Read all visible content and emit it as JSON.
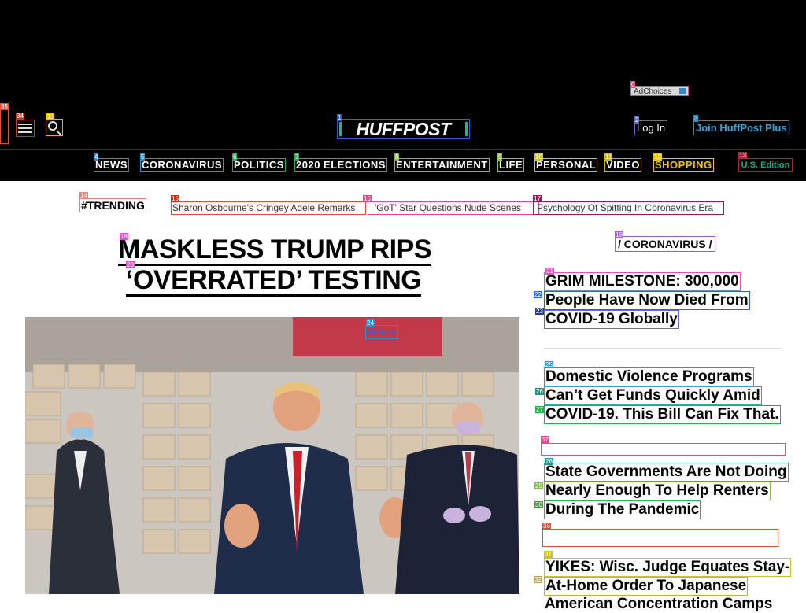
{
  "ad": {
    "label": "AdChoices"
  },
  "header": {
    "logo": "HUFFPOST",
    "login": "Log In",
    "join_plus": "Join HuffPost Plus",
    "edition": "U.S. Edition"
  },
  "nav": [
    {
      "label": "NEWS",
      "color": "#2a8bcf"
    },
    {
      "label": "CORONAVIRUS",
      "color": "#1a9ad6"
    },
    {
      "label": "POLITICS",
      "color": "#1eb34a"
    },
    {
      "label": "2020 ELECTIONS",
      "color": "#2cb44a"
    },
    {
      "label": "ENTERTAINMENT",
      "color": "#7cc040"
    },
    {
      "label": "LIFE",
      "color": "#8ac53f"
    },
    {
      "label": "PERSONAL",
      "color": "#d4c21c"
    },
    {
      "label": "VIDEO",
      "color": "#c9b21a"
    },
    {
      "label": "SHOPPING",
      "color": "#f6c200"
    }
  ],
  "trending": {
    "label": "#TRENDING",
    "items": [
      "Sharon Osbourne's Cringey Adele Remarks",
      "'GoT' Star Questions Nude Scenes",
      "Psychology Of Spitting In Coronavirus Era"
    ]
  },
  "main": {
    "headline_line1": "MASKLESS TRUMP RIPS",
    "headline_line2": "‘OVERRATED’ TESTING",
    "image_sign": "&Minor"
  },
  "sidebar": {
    "section": "/ CORONAVIRUS /",
    "story1": [
      "GRIM MILESTONE: 300,000",
      "People Have Now Died From",
      "COVID-19 Globally"
    ],
    "story2": [
      "Domestic Violence Programs",
      "Can’t Get Funds Quickly Amid",
      "COVID-19. This Bill Can Fix That."
    ],
    "story3": [
      "State Governments Are Not Doing",
      "Nearly Enough To Help Renters",
      "During The Pandemic"
    ],
    "story4": [
      "YIKES: Wisc. Judge Equates Stay-",
      "At-Home Order To Japanese",
      "American Concentration Camps"
    ]
  },
  "badges": [
    "0",
    "1",
    "2",
    "3",
    "4",
    "5",
    "6",
    "7",
    "8",
    "9",
    "10",
    "11",
    "12",
    "13",
    "14",
    "15",
    "16",
    "17",
    "18",
    "19",
    "20",
    "21",
    "22",
    "23",
    "24",
    "25",
    "26",
    "27",
    "28",
    "29",
    "30",
    "31",
    "32",
    "33",
    "34",
    "35",
    "36",
    "37"
  ]
}
